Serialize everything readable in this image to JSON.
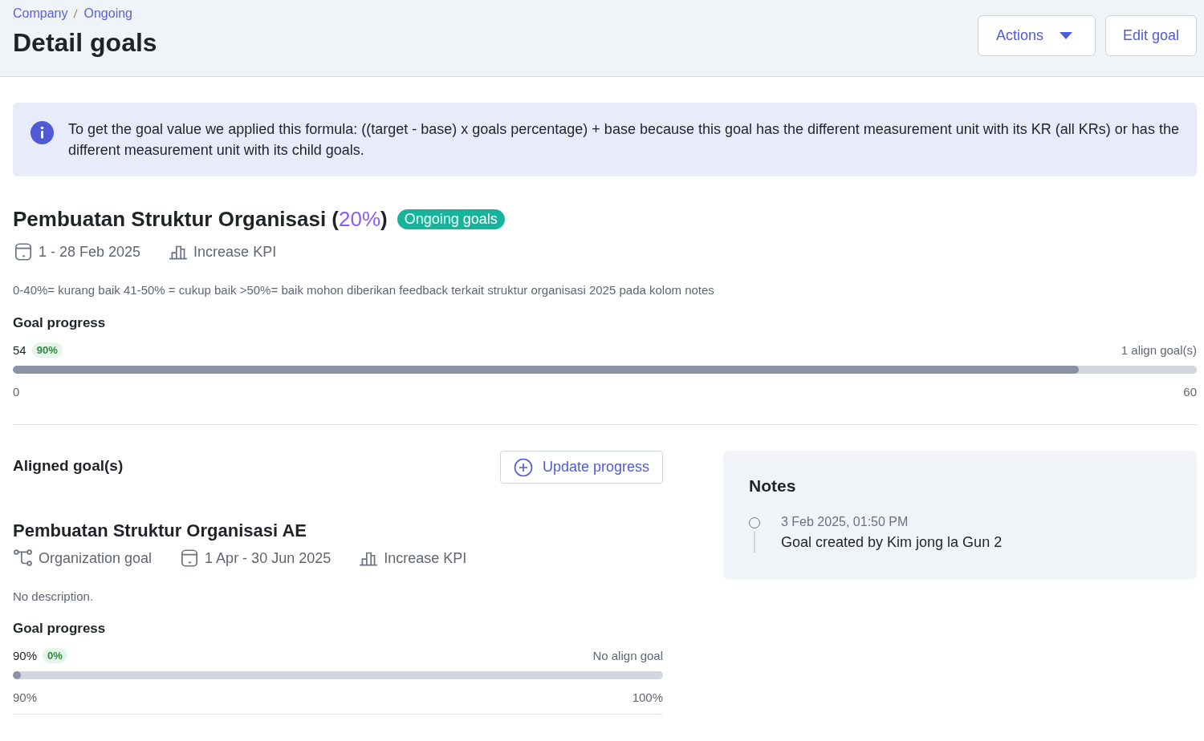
{
  "breadcrumb": [
    "Company",
    "Ongoing"
  ],
  "page_title": "Detail goals",
  "header_buttons": [
    {
      "label": "Actions",
      "kind": "dropdown"
    },
    {
      "label": "Edit goal",
      "kind": "plain"
    }
  ],
  "info_banner": "To get the goal value we applied this formula: ((target - base) x goals percentage) + base because this goal has the different measurement unit with its KR (all KRs) or has the different measurement unit with its child goals.",
  "goal": {
    "title_prefix": "Pembuatan Struktur Organisasi (",
    "percent": "20%",
    "title_suffix": ")",
    "status": "Ongoing goals",
    "period": "1 - 28 Feb 2025",
    "kpi": "Increase KPI",
    "description": "0-40%= kurang baik 41-50% = cukup baik >50%= baik mohon diberikan feedback terkait struktur organisasi 2025 pada kolom notes",
    "progress_title": "Goal progress",
    "current": "54",
    "badge": "90%",
    "align": "1 align goal(s)",
    "level": 0.9,
    "min": "0",
    "max": "60"
  },
  "aligned": {
    "title": "Aligned goal(s)",
    "update_button": "Update progress",
    "goals": [
      {
        "title": "Pembuatan Struktur Organisasi AE",
        "type": "Organization goal",
        "period": "1 Apr - 30 Jun 2025",
        "kpi": "Increase KPI",
        "description": "No description.",
        "progress_title": "Goal progress",
        "current": "90%",
        "badge": "0%",
        "align": "No align goal",
        "level": 0,
        "min": "90%",
        "max": "100%"
      }
    ]
  },
  "notes": {
    "title": "Notes",
    "entries": [
      {
        "time": "3 Feb 2025, 01:50 PM",
        "text": "Goal created by Kim jong la Gun 2"
      }
    ]
  }
}
